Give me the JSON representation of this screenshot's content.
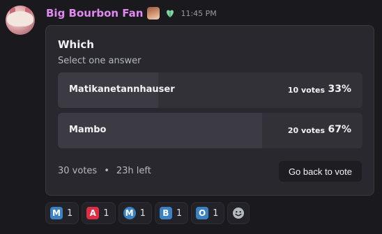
{
  "message": {
    "username": "Big Bourbon Fan",
    "timestamp": "11:45 PM",
    "badges": [
      "horse-girl-emoji",
      "heart-leaf-emoji"
    ]
  },
  "poll": {
    "question": "Which",
    "hint": "Select one answer",
    "answers": [
      {
        "label": "Matikanetannhauser",
        "votes": "10 votes",
        "percent": "33%",
        "fraction": 0.33
      },
      {
        "label": "Mambo",
        "votes": "20 votes",
        "percent": "67%",
        "fraction": 0.67
      }
    ],
    "total_votes": "30 votes",
    "separator": "•",
    "time_left": "23h left",
    "back_button": "Go back to vote"
  },
  "reactions": [
    {
      "icon": "letter-m-blue",
      "letter": "M",
      "count": "1",
      "color": "#3b82c4"
    },
    {
      "icon": "letter-a-red",
      "letter": "A",
      "count": "1",
      "color": "#dd2e44"
    },
    {
      "icon": "letter-m-circle",
      "letter": "M",
      "count": "1",
      "color": "#3b82c4"
    },
    {
      "icon": "letter-b-blue",
      "letter": "B",
      "count": "1",
      "color": "#3b82c4"
    },
    {
      "icon": "letter-o-blue",
      "letter": "O",
      "count": "1",
      "color": "#3b82c4"
    }
  ],
  "colors": {
    "username": "#e089f0",
    "poll_bg": "#29282e",
    "answer_bg": "#323138",
    "answer_fill": "#3c3b43"
  }
}
